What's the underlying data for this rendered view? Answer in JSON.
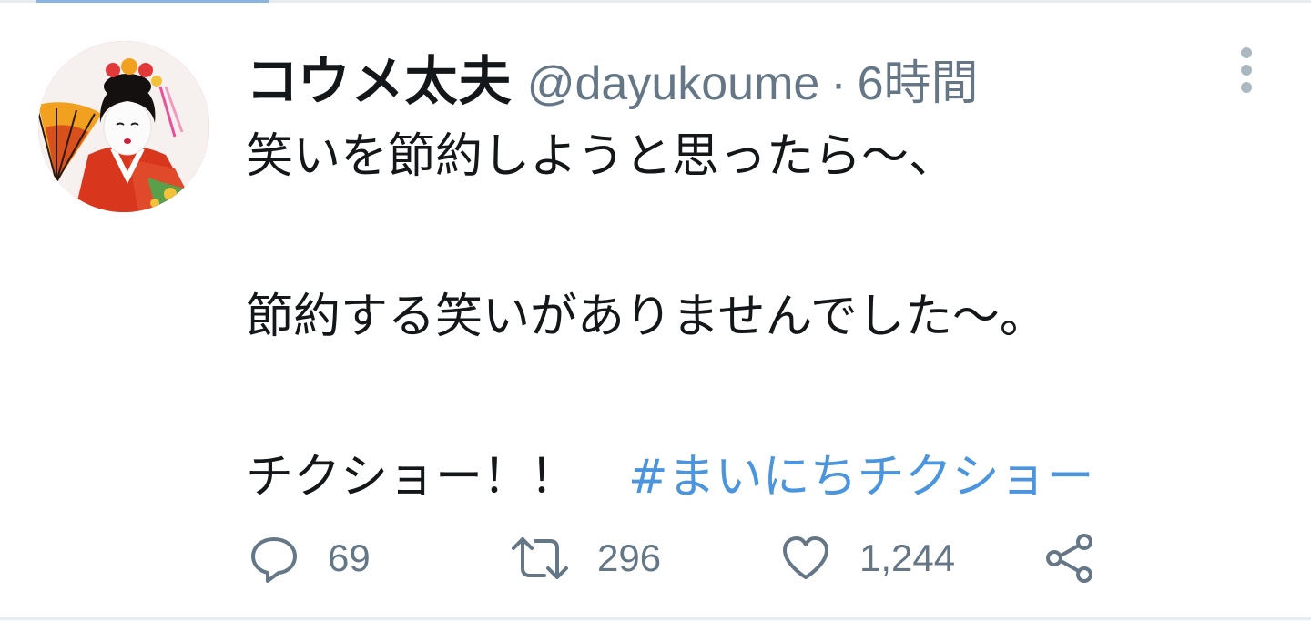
{
  "tweet": {
    "author_name": "コウメ太夫",
    "handle": "@dayukoume",
    "separator": "·",
    "timestamp": "6時間",
    "lines": [
      "笑いを節約しようと思ったら〜、",
      "節約する笑いがありませんでした〜。",
      "チクショー！！"
    ],
    "hashtag": "#まいにちチクショー"
  },
  "actions": {
    "replies": "69",
    "retweets": "296",
    "likes": "1,244"
  },
  "icons": {
    "reply": "reply-icon",
    "retweet": "retweet-icon",
    "like": "heart-icon",
    "share": "share-icon",
    "more": "more-vertical-icon"
  },
  "colors": {
    "hashtag": "#4a95de",
    "muted": "#657786",
    "avatar_ring": "#e8509a"
  }
}
